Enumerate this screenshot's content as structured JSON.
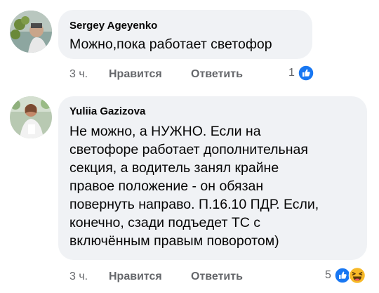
{
  "comments": [
    {
      "author": "Sergey Ageyenko",
      "text": "Можно,пока работает светофор",
      "time": "3 ч.",
      "like_label": "Нравится",
      "reply_label": "Ответить",
      "reaction_count": "1"
    },
    {
      "author": "Yuliia Gazizova",
      "lines": [
        "Не можно, а НУЖНО. Если на",
        "светофоре работает дополнительная",
        "секция, а водитель занял крайне",
        "правое положение - он обязан",
        "повернуть направо. П.16.10 ПДР. Если,",
        "конечно, сзади подъедет ТС с",
        "включённым правым поворотом)"
      ],
      "time": "3 ч.",
      "like_label": "Нравится",
      "reply_label": "Ответить",
      "reaction_count": "5"
    }
  ],
  "colors": {
    "bubble": "#f0f2f5",
    "secondary_text": "#65676b",
    "like_blue": "#1877f2",
    "haha_yellow": "#f7b928"
  },
  "icons": [
    "like-reaction-icon",
    "haha-reaction-icon"
  ]
}
